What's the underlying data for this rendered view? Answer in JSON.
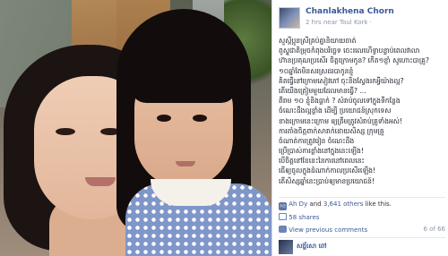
{
  "post": {
    "author_name": "Chanlakhena Chorn",
    "timestamp": "2 hrs near Toul Kork · ",
    "body_lines": [
      "សួស្តីប្អូនស្រីគ្រប់គ្នានិយាយចាត់",
      "ពូស្ទូជាតិម្រុចកំពុងបរិច្ឆេទ ចេះរលេហើទ្ធាបន្ទាប់ពេលវាលា",
      "ហ៊ានប្រគុណប្រសើរ ចិត្តក្រោមកូន? កើត១ខ្ញាំ សូហោះបាគ្រូ?",
      "១០ឆ្នាំតែមិនសរស្រដរបាកូនខ្ញុំ",
      "គិតធ្វើនៅក្រោមសៀវភៅ ចុះនិងស្វែងរកអ្វីយ៉ាងល្អ?",
      "តើយើងត្រៀមមួយដែលមានធ្វើ? ...",
      "ពីរាម ១០ ខ្ញុំនិងធ្លាក់ ? សំរាប់ចូលទៅក្នុងទីកន្លែង",
      "ចំណេះដឹងល្អខ្លាំង ដើម្បី ប្រយោជន៍ស្រុកទេស",
      "ខាងក្រោមនេះក្រោម ឲ្យត្រឹមត្រូវសំរាប់គ្រូទាំងអស់!",
      "ការតាំងចិត្តពាក់សារាក់ដោយសិស្ស ក្រុមគ្រួ",
      "ចំណាត់ការត្រូវរៀន ចំណេះដឹង",
      "ប្រើប្រាស់ការខ្លាំងនៅក្នុងនេះឡើង!",
      "បើចិត្តនៅខែនេះនៃការនៅពេលនេះ",
      "ធើឲ្យចូលក្នុងដំណាក់កាលប្រសើរឡើង!",
      "តើសិស្សឆ្នាំនេះប្រាប់ឲ្យមានប្រយោជន៍!"
    ]
  },
  "engagement": {
    "likes_prefix": "Ah Dy",
    "likes_and": "and",
    "likes_others": "3,641 others",
    "likes_suffix": "like this.",
    "shares": "58 shares",
    "view_previous": "View previous comments",
    "comment_count": "6 of 66"
  },
  "commenter": {
    "name": "សង្ហ័សោ ពៅ"
  },
  "icons": {
    "like": "thumbs-up-icon",
    "share": "share-icon",
    "comment": "comment-icon"
  },
  "colors": {
    "link": "#3b5998",
    "meta": "#8b96a8",
    "body": "#141823"
  }
}
